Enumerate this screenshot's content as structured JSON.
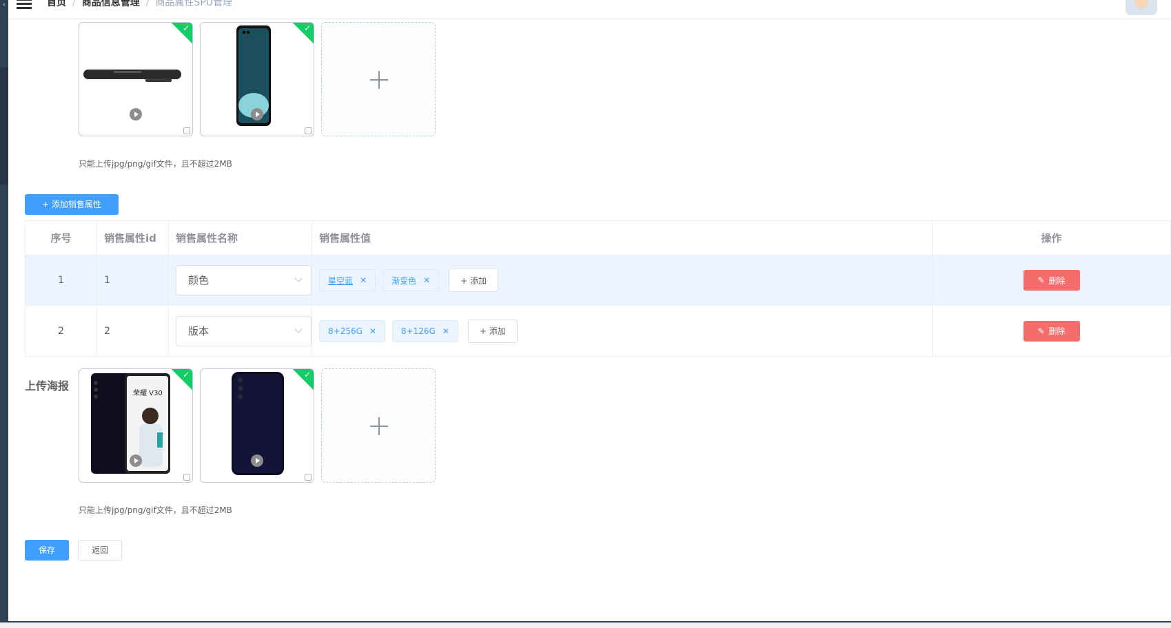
{
  "header": {
    "breadcrumb": [
      "首页",
      "商品信息管理",
      "商品属性SPU管理"
    ]
  },
  "images_upload": {
    "tip": "只能上传jpg/png/gif文件，且不超过2MB"
  },
  "add_sale_attr_button": "+ 添加销售属性",
  "table": {
    "columns": [
      "序号",
      "销售属性id",
      "销售属性名称",
      "销售属性值",
      "操作"
    ],
    "rows": [
      {
        "index": "1",
        "id": "1",
        "name": "颜色",
        "values": [
          "星空蓝",
          "渐变色"
        ],
        "add_label": "+ 添加",
        "delete_label": "删除"
      },
      {
        "index": "2",
        "id": "2",
        "name": "版本",
        "values": [
          "8+256G",
          "8+126G"
        ],
        "add_label": "+ 添加",
        "delete_label": "删除"
      }
    ]
  },
  "poster_upload": {
    "label": "上传海报",
    "tip": "只能上传jpg/png/gif文件，且不超过2MB",
    "poster_brand_text": "荣耀 V30"
  },
  "footer": {
    "save_label": "保存",
    "back_label": "返回"
  },
  "colors": {
    "primary": "#409eff",
    "danger": "#f56c6c",
    "success": "#13ce66",
    "sidebar": "#304156"
  }
}
